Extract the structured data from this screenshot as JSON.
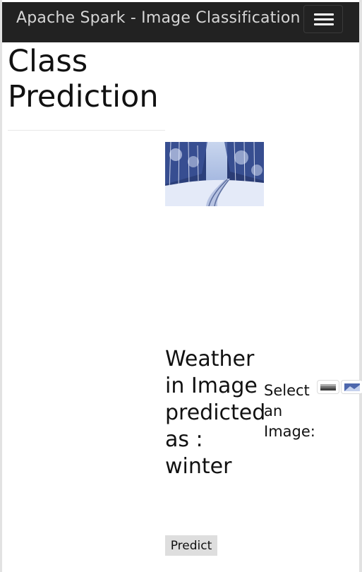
{
  "navbar": {
    "brand": "Apache Spark - Image Classification",
    "menu_icon": "hamburger-menu-icon"
  },
  "page": {
    "title": "Class Prediction"
  },
  "prediction": {
    "text": "Weather in Image predicted as : winter"
  },
  "selector": {
    "label": "Select an Image:",
    "options": [
      "image-thumbnail-1",
      "image-thumbnail-2"
    ]
  },
  "actions": {
    "predict_label": "Predict"
  },
  "colors": {
    "navbar_bg": "#222222",
    "brand_text": "#d6d6d6",
    "button_bg": "#dedede"
  }
}
